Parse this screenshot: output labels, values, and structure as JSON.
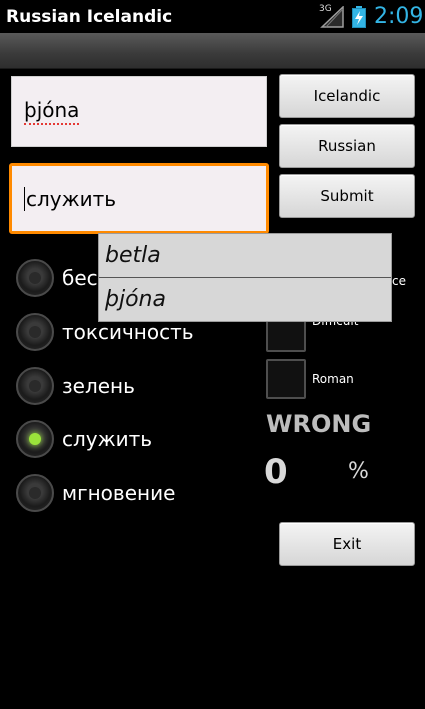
{
  "status_bar": {
    "network": "3G",
    "time": "2:09"
  },
  "app": {
    "title": "Russian Icelandic"
  },
  "fields": {
    "word": "þjóna",
    "answer": "служить"
  },
  "buttons": {
    "icelandic": "Icelandic",
    "russian": "Russian",
    "submit": "Submit",
    "exit": "Exit"
  },
  "options": [
    {
      "label": "бес",
      "selected": false
    },
    {
      "label": "токсичность",
      "selected": false
    },
    {
      "label": "зелень",
      "selected": false
    },
    {
      "label": "служить",
      "selected": true
    },
    {
      "label": "мгновение",
      "selected": false
    }
  ],
  "checkboxes": [
    {
      "label": "ce",
      "checked": false
    },
    {
      "label": "Difficult",
      "checked": false
    },
    {
      "label": "Roman",
      "checked": false
    }
  ],
  "result": {
    "status": "WRONG",
    "score": "0",
    "percent_sign": "%"
  },
  "suggestions": [
    "betla",
    "þjóna"
  ],
  "colors": {
    "focus": "#ff8a00",
    "radio_on": "#9be33b",
    "clock": "#33b5e5"
  }
}
